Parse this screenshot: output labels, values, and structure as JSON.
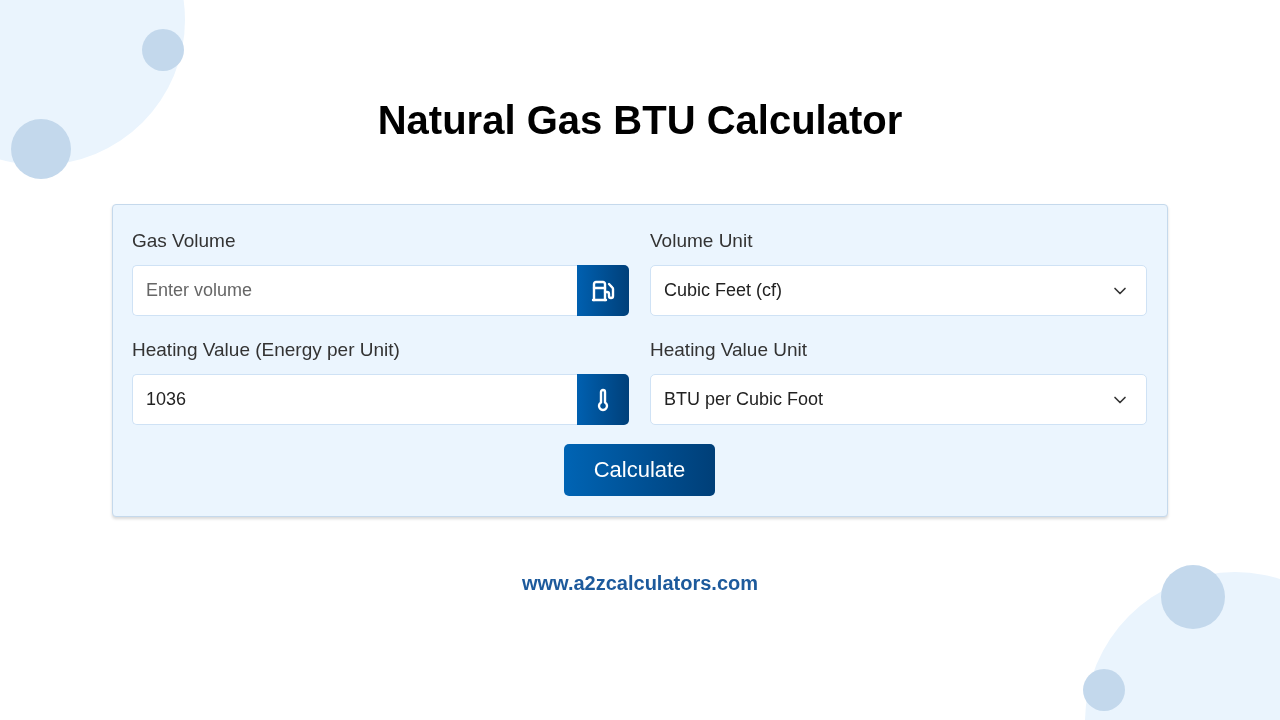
{
  "title": "Natural Gas BTU Calculator",
  "fields": [
    {
      "kind": "volume",
      "label": "Gas Volume",
      "placeholder": "Enter volume"
    },
    {
      "kind": "select",
      "label": "Volume Unit",
      "value": "Cubic Feet (cf)"
    },
    {
      "kind": "energy",
      "label": "Heating Value (Energy per Unit)",
      "value": "1036"
    },
    {
      "kind": "select",
      "label": "Heating Value Unit",
      "value": "BTU per Cubic Foot"
    }
  ],
  "button": "Calculate",
  "website": "www.a2zcalculators.com"
}
